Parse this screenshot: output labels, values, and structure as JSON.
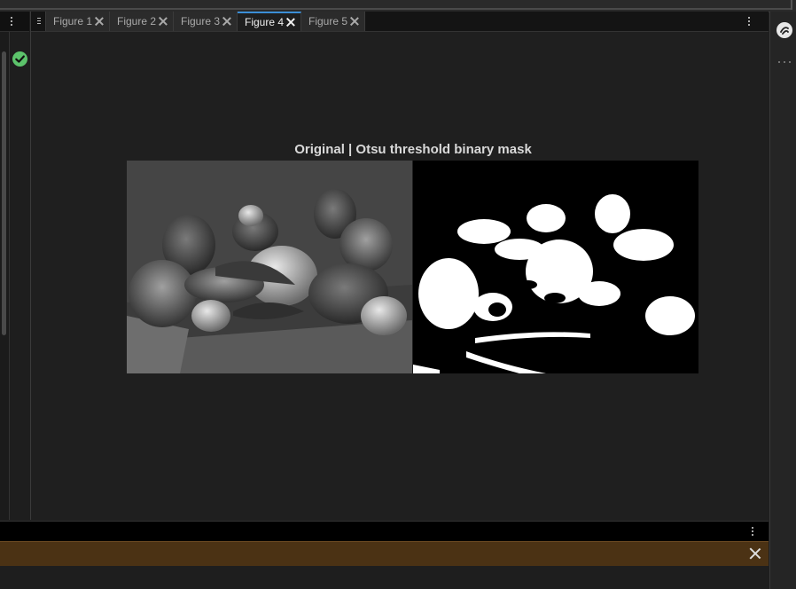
{
  "tabs": [
    {
      "label": "Figure 1",
      "active": false
    },
    {
      "label": "Figure 2",
      "active": false
    },
    {
      "label": "Figure 3",
      "active": false
    },
    {
      "label": "Figure 4",
      "active": true
    },
    {
      "label": "Figure 5",
      "active": false
    }
  ],
  "figure": {
    "title": "Original | Otsu threshold binary mask"
  },
  "status": {
    "icon": "check-circle-icon",
    "color": "#5cc36b"
  },
  "colors": {
    "active_tab_accent": "#3b8ed6",
    "notification_bg": "#4b3214"
  },
  "icons": {
    "left_menu": "kebab-menu-icon",
    "tab_menu": "kebab-menu-icon",
    "right_rail_top": "plugin-icon",
    "right_rail_more": "more-horizontal-icon",
    "bottom_menu": "kebab-menu-icon",
    "notification_close": "close-icon"
  }
}
